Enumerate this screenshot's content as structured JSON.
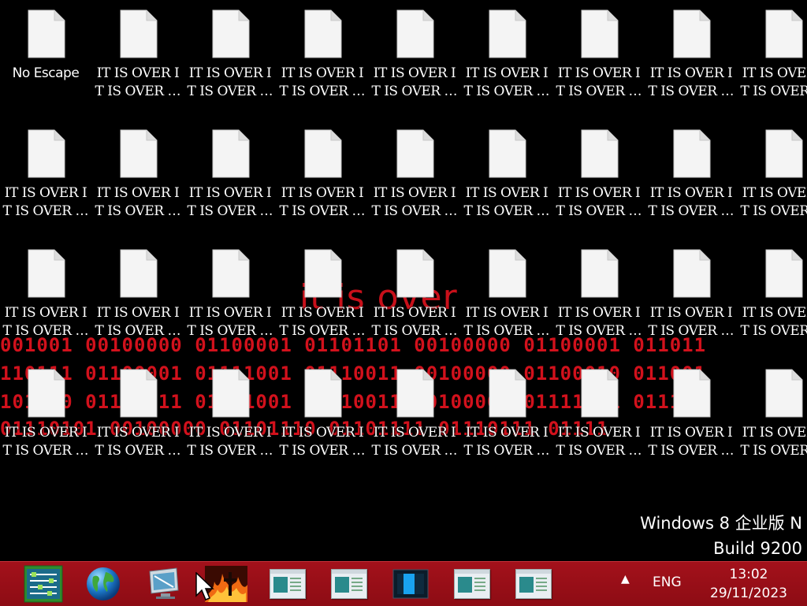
{
  "desktop": {
    "background": {
      "headline": "it is over",
      "binary_lines": [
        "001001 00100000 01100001 01101101 00100000 01100001 011011",
        "110111 01100001 01111001 01110011 00100000 01100010 011001",
        "101000 01110011 01111001 01110011 00100000 01111001 011101",
        "         01110101 00100000 01101110 01101111 01110111 01111"
      ],
      "accent_color": "#d2111c"
    },
    "icons": [
      {
        "label": "No Escape"
      },
      {
        "label": "IT IS OVER IT IS OVER IT ..."
      },
      {
        "label": "IT IS OVER IT IS OVER IT ..."
      },
      {
        "label": "IT IS OVER IT IS OVER IT ..."
      },
      {
        "label": "IT IS OVER IT IS OVER IT ..."
      },
      {
        "label": "IT IS OVER IT IS OVER IT ..."
      },
      {
        "label": "IT IS OVER IT IS OVER IT ..."
      },
      {
        "label": "IT IS OVER IT IS OVER IT ..."
      },
      {
        "label": "IT IS OVER IT IS OVER IT ..."
      },
      {
        "label": "IT IS OVER IT IS OVER IT ..."
      },
      {
        "label": "IT IS OVER IT IS OVER IT ..."
      },
      {
        "label": "IT IS OVER IT IS OVER IT ..."
      },
      {
        "label": "IT IS OVER IT IS OVER IT ..."
      },
      {
        "label": "IT IS OVER IT IS OVER IT ..."
      },
      {
        "label": "IT IS OVER IT IS OVER IT ..."
      },
      {
        "label": "IT IS OVER IT IS OVER IT ..."
      },
      {
        "label": "IT IS OVER IT IS OVER IT ..."
      },
      {
        "label": "IT IS OVER IT IS OVER IT ..."
      },
      {
        "label": "IT IS OVER IT IS OVER IT ..."
      },
      {
        "label": "IT IS OVER IT IS OVER IT ..."
      },
      {
        "label": "IT IS OVER IT IS OVER IT ..."
      },
      {
        "label": "IT IS OVER IT IS OVER IT ..."
      },
      {
        "label": "IT IS OVER IT IS OVER IT ..."
      },
      {
        "label": "IT IS OVER IT IS OVER IT ..."
      },
      {
        "label": "IT IS OVER IT IS OVER IT ..."
      },
      {
        "label": "IT IS OVER IT IS OVER IT ..."
      },
      {
        "label": "IT IS OVER IT IS OVER IT ..."
      },
      {
        "label": "IT IS OVER IT IS OVER IT ..."
      },
      {
        "label": "IT IS OVER IT IS OVER IT ..."
      },
      {
        "label": "IT IS OVER IT IS OVER IT ..."
      },
      {
        "label": "IT IS OVER IT IS OVER IT ..."
      },
      {
        "label": "IT IS OVER IT IS OVER IT ..."
      },
      {
        "label": "IT IS OVER IT IS OVER IT ..."
      },
      {
        "label": "IT IS OVER IT IS OVER IT ..."
      },
      {
        "label": "IT IS OVER IT IS OVER IT ..."
      },
      {
        "label": "IT IS OVER IT IS OVER IT ..."
      }
    ],
    "watermark": {
      "line1": "Windows 8 企业版 N",
      "line2": "Build 9200"
    }
  },
  "taskbar": {
    "color": "#a3111b",
    "buttons": [
      {
        "name": "network-app-icon"
      },
      {
        "name": "globe-browser-icon"
      },
      {
        "name": "display-settings-icon"
      },
      {
        "name": "fire-cross-icon"
      },
      {
        "name": "window-icon"
      },
      {
        "name": "window-icon"
      },
      {
        "name": "blue-window-icon"
      },
      {
        "name": "window-icon"
      },
      {
        "name": "window-icon"
      }
    ],
    "tray": {
      "chevron": "▲",
      "language": "ENG",
      "time": "13:02",
      "date": "29/11/2023"
    }
  }
}
